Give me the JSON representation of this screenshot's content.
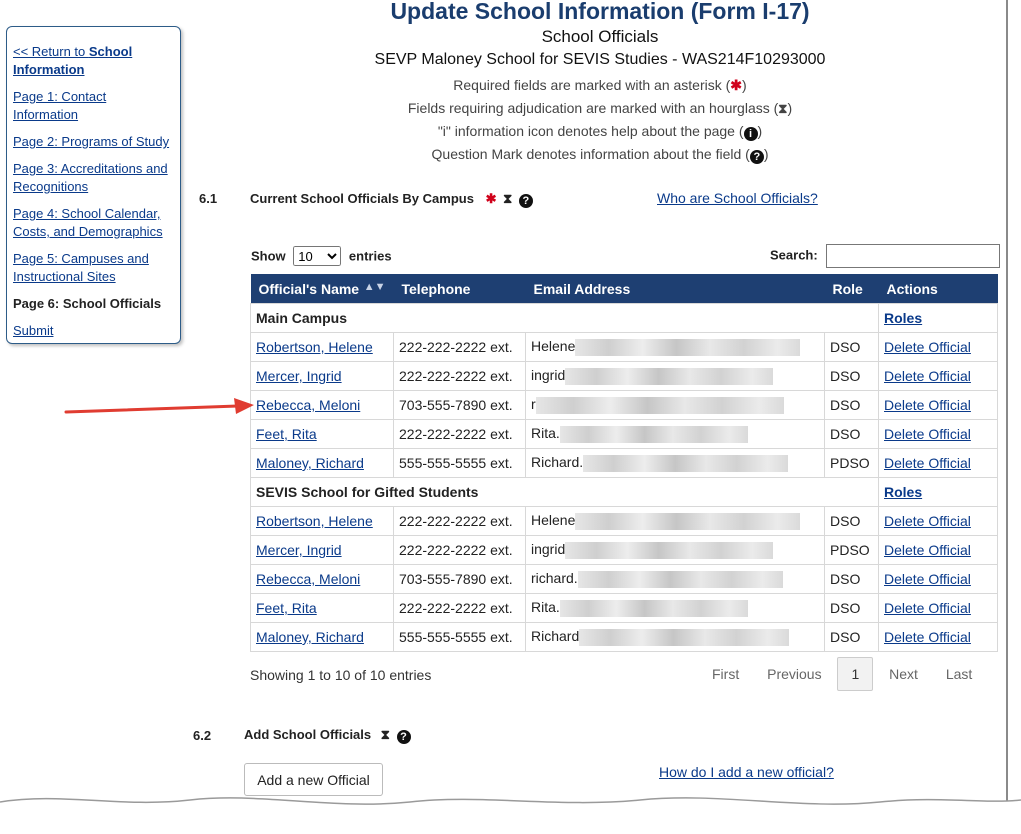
{
  "sidebar": {
    "return_prefix": "<< Return to ",
    "return_bold": "School Information",
    "items": [
      {
        "label": "Page 1: Contact Information"
      },
      {
        "label": "Page 2: Programs of Study"
      },
      {
        "label": "Page 3: Accreditations and Recognitions"
      },
      {
        "label": "Page 4: School Calendar, Costs, and Demographics"
      },
      {
        "label": "Page 5: Campuses and Instructional Sites"
      },
      {
        "label": "Page 6: School Officials"
      },
      {
        "label": "Submit"
      }
    ]
  },
  "header": {
    "title": "Update School Information (Form I-17)",
    "subtitle": "School Officials",
    "school": "SEVP Maloney School for SEVIS Studies - WAS214F10293000",
    "notes": {
      "required": "Required fields are marked with an asterisk (",
      "adjudication": "Fields requiring adjudication are marked with an hourglass (",
      "info": "\"i\" information icon denotes help about the page (",
      "question": "Question Mark denotes information about the field ("
    },
    "close_paren": ")"
  },
  "section1": {
    "number": "6.1",
    "title": "Current School Officials By Campus",
    "help_link": "Who are School Officials?"
  },
  "table_controls": {
    "show_label": "Show",
    "entries_value": "10",
    "entries_label": "entries",
    "search_label": "Search:"
  },
  "table": {
    "headers": {
      "name": "Official's Name",
      "phone": "Telephone",
      "email": "Email Address",
      "role": "Role",
      "actions": "Actions"
    },
    "roles_link": "Roles",
    "delete_label": "Delete Official",
    "groups": [
      {
        "campus": "Main Campus",
        "rows": [
          {
            "name": "Robertson, Helene",
            "phone": "222-222-2222 ext.",
            "email": "Helene",
            "role": "DSO"
          },
          {
            "name": "Mercer, Ingrid",
            "phone": "222-222-2222 ext.",
            "email": "ingrid",
            "role": "DSO"
          },
          {
            "name": "Rebecca, Meloni",
            "phone": "703-555-7890 ext.",
            "email": "r",
            "role": "DSO"
          },
          {
            "name": "Feet, Rita",
            "phone": "222-222-2222 ext.",
            "email": "Rita.",
            "role": "DSO"
          },
          {
            "name": "Maloney, Richard",
            "phone": "555-555-5555 ext.",
            "email": "Richard.",
            "role": "PDSO"
          }
        ]
      },
      {
        "campus": "SEVIS School for Gifted Students",
        "rows": [
          {
            "name": "Robertson, Helene",
            "phone": "222-222-2222 ext.",
            "email": "Helene",
            "role": "DSO"
          },
          {
            "name": "Mercer, Ingrid",
            "phone": "222-222-2222 ext.",
            "email": "ingrid",
            "role": "PDSO"
          },
          {
            "name": "Rebecca, Meloni",
            "phone": "703-555-7890 ext.",
            "email": "richard.",
            "role": "DSO"
          },
          {
            "name": "Feet, Rita",
            "phone": "222-222-2222 ext.",
            "email": "Rita.",
            "role": "DSO"
          },
          {
            "name": "Maloney, Richard",
            "phone": "555-555-5555 ext.",
            "email": "Richard",
            "role": "DSO"
          }
        ]
      }
    ]
  },
  "table_footer": {
    "info": "Showing 1 to 10 of 10 entries",
    "pager": {
      "first": "First",
      "previous": "Previous",
      "current": "1",
      "next": "Next",
      "last": "Last"
    }
  },
  "section2": {
    "number": "6.2",
    "title": "Add School Officials",
    "add_button": "Add a new Official",
    "help_link": "How do I add a new official?"
  },
  "icons": {
    "asterisk": "asterisk-icon",
    "hourglass": "hourglass-icon",
    "info": "info-icon",
    "question": "question-icon"
  },
  "colors": {
    "title": "#1a3d6e",
    "header_bg": "#1e3f72",
    "asterisk": "#d0021b",
    "annotation_arrow": "#e03c31"
  }
}
